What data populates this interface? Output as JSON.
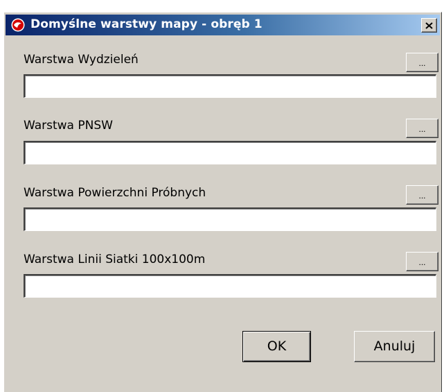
{
  "window": {
    "title": "Domyślne warstwy mapy - obręb 1",
    "icon": "app-logo-icon",
    "close_icon": "close-icon",
    "close_symbol": "✕",
    "colors": {
      "titlebar_start": "#0a246a",
      "titlebar_end": "#a6caf0",
      "face": "#d4d0c8",
      "field_bg": "#ffffff",
      "icon_red": "#d40000"
    }
  },
  "fields": [
    {
      "label": "Warstwa Wydzieleń",
      "value": "",
      "browse_label": "..."
    },
    {
      "label": "Warstwa PNSW",
      "value": "",
      "browse_label": "..."
    },
    {
      "label": "Warstwa Powierzchni Próbnych",
      "value": "",
      "browse_label": "..."
    },
    {
      "label": "Warstwa Linii Siatki 100x100m",
      "value": "",
      "browse_label": "..."
    }
  ],
  "buttons": {
    "ok_label": "OK",
    "cancel_label": "Anuluj"
  }
}
